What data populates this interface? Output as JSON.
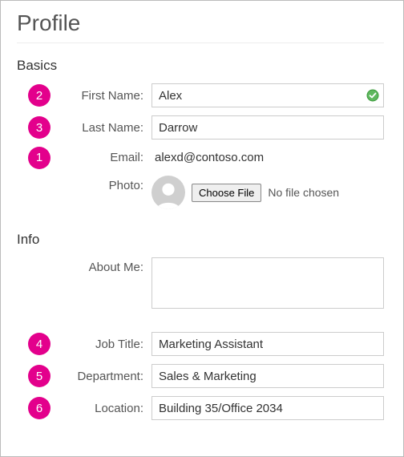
{
  "page": {
    "title": "Profile"
  },
  "sections": {
    "basics": {
      "title": "Basics",
      "first_name": {
        "label": "First Name:",
        "value": "Alex",
        "badge": "2",
        "validated": true
      },
      "last_name": {
        "label": "Last Name:",
        "value": "Darrow",
        "badge": "3"
      },
      "email": {
        "label": "Email:",
        "value": "alexd@contoso.com",
        "badge": "1"
      },
      "photo": {
        "label": "Photo:",
        "button": "Choose File",
        "status": "No file chosen"
      }
    },
    "info": {
      "title": "Info",
      "about_me": {
        "label": "About Me:",
        "value": ""
      },
      "job_title": {
        "label": "Job Title:",
        "value": "Marketing Assistant",
        "badge": "4"
      },
      "department": {
        "label": "Department:",
        "value": "Sales & Marketing",
        "badge": "5"
      },
      "location": {
        "label": "Location:",
        "value": "Building 35/Office 2034",
        "badge": "6"
      }
    }
  }
}
